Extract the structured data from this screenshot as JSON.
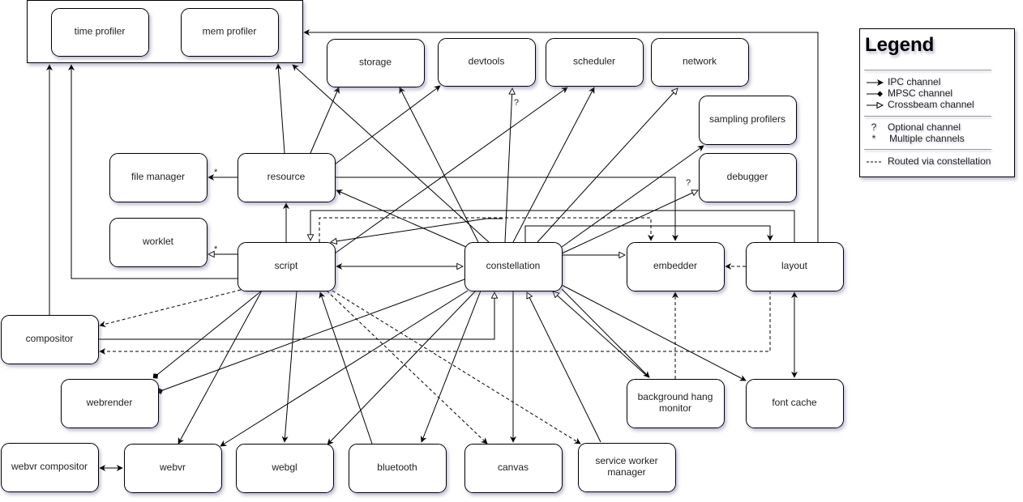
{
  "nodes": [
    {
      "id": "profilers_group",
      "label": ""
    },
    {
      "id": "time_profiler",
      "label": "time profiler"
    },
    {
      "id": "mem_profiler",
      "label": "mem profiler"
    },
    {
      "id": "storage",
      "label": "storage"
    },
    {
      "id": "devtools",
      "label": "devtools"
    },
    {
      "id": "scheduler",
      "label": "scheduler"
    },
    {
      "id": "network",
      "label": "network"
    },
    {
      "id": "sampling_profilers",
      "label": "sampling profilers"
    },
    {
      "id": "debugger",
      "label": "debugger"
    },
    {
      "id": "file_manager",
      "label": "file manager"
    },
    {
      "id": "resource",
      "label": "resource"
    },
    {
      "id": "worklet",
      "label": "worklet"
    },
    {
      "id": "script",
      "label": "script"
    },
    {
      "id": "constellation",
      "label": "constellation"
    },
    {
      "id": "embedder",
      "label": "embedder"
    },
    {
      "id": "layout",
      "label": "layout"
    },
    {
      "id": "compositor",
      "label": "compositor"
    },
    {
      "id": "webrender",
      "label": "webrender"
    },
    {
      "id": "background_hang_monitor",
      "label": "background hang\nmonitor"
    },
    {
      "id": "font_cache",
      "label": "font cache"
    },
    {
      "id": "webvr_compositor",
      "label": "webvr compositor"
    },
    {
      "id": "webvr",
      "label": "webvr"
    },
    {
      "id": "webgl",
      "label": "webgl"
    },
    {
      "id": "bluetooth",
      "label": "bluetooth"
    },
    {
      "id": "canvas",
      "label": "canvas"
    },
    {
      "id": "service_worker_manager",
      "label": "service worker\nmanager"
    }
  ],
  "edges": [
    {
      "from": "resource",
      "to": "file_manager",
      "type": "ipc",
      "mark": "*"
    },
    {
      "from": "resource",
      "to": "mem_profiler",
      "type": "ipc"
    },
    {
      "from": "resource",
      "to": "storage",
      "type": "ipc"
    },
    {
      "from": "resource",
      "to": "devtools",
      "type": "ipc"
    },
    {
      "from": "resource",
      "to": "embedder",
      "type": "ipc"
    },
    {
      "from": "script",
      "to": "resource",
      "type": "ipc"
    },
    {
      "from": "script",
      "to": "worklet",
      "type": "crossbeam",
      "mark": "*"
    },
    {
      "from": "script",
      "to": "time_profiler",
      "type": "ipc"
    },
    {
      "from": "script",
      "to": "devtools",
      "type": "ipc"
    },
    {
      "from": "script",
      "to": "constellation",
      "type": "ipc",
      "bidirectional": true
    },
    {
      "from": "script",
      "to": "compositor",
      "type": "ipc",
      "style": "dashed"
    },
    {
      "from": "script",
      "to": "webrender",
      "type": "mpsc"
    },
    {
      "from": "script",
      "to": "webvr",
      "type": "ipc"
    },
    {
      "from": "script",
      "to": "webgl",
      "type": "ipc"
    },
    {
      "from": "script",
      "to": "canvas",
      "type": "ipc",
      "style": "dashed"
    },
    {
      "from": "script",
      "to": "service_worker_manager",
      "type": "ipc",
      "style": "dashed"
    },
    {
      "from": "script",
      "to": "embedder",
      "type": "ipc",
      "style": "dashed"
    },
    {
      "from": "bluetooth",
      "to": "script",
      "type": "ipc"
    },
    {
      "from": "constellation",
      "to": "mem_profiler",
      "type": "ipc"
    },
    {
      "from": "constellation",
      "to": "storage",
      "type": "ipc"
    },
    {
      "from": "constellation",
      "to": "devtools",
      "type": "crossbeam",
      "mark": "?"
    },
    {
      "from": "constellation",
      "to": "scheduler",
      "type": "ipc"
    },
    {
      "from": "constellation",
      "to": "network",
      "type": "crossbeam"
    },
    {
      "from": "constellation",
      "to": "sampling_profilers",
      "type": "ipc"
    },
    {
      "from": "constellation",
      "to": "debugger",
      "type": "crossbeam",
      "mark": "?"
    },
    {
      "from": "constellation",
      "to": "resource",
      "type": "ipc"
    },
    {
      "from": "constellation",
      "to": "script",
      "type": "crossbeam"
    },
    {
      "from": "constellation",
      "to": "embedder",
      "type": "crossbeam"
    },
    {
      "from": "constellation",
      "to": "layout",
      "type": "ipc"
    },
    {
      "from": "constellation",
      "to": "webrender",
      "type": "mpsc"
    },
    {
      "from": "constellation",
      "to": "webvr",
      "type": "ipc"
    },
    {
      "from": "constellation",
      "to": "webgl",
      "type": "ipc"
    },
    {
      "from": "constellation",
      "to": "bluetooth",
      "type": "ipc"
    },
    {
      "from": "constellation",
      "to": "canvas",
      "type": "ipc"
    },
    {
      "from": "constellation",
      "to": "background_hang_monitor",
      "type": "ipc"
    },
    {
      "from": "constellation",
      "to": "font_cache",
      "type": "ipc"
    },
    {
      "from": "compositor",
      "to": "constellation",
      "type": "crossbeam"
    },
    {
      "from": "compositor",
      "to": "time_profiler",
      "type": "ipc"
    },
    {
      "from": "service_worker_manager",
      "to": "constellation",
      "type": "crossbeam"
    },
    {
      "from": "background_hang_monitor",
      "to": "constellation",
      "type": "crossbeam"
    },
    {
      "from": "background_hang_monitor",
      "to": "embedder",
      "type": "ipc",
      "style": "dashed"
    },
    {
      "from": "layout",
      "to": "embedder",
      "type": "ipc",
      "style": "dashed"
    },
    {
      "from": "layout",
      "to": "compositor",
      "type": "ipc",
      "style": "dashed"
    },
    {
      "from": "layout",
      "to": "profilers_group",
      "type": "ipc"
    },
    {
      "from": "layout",
      "to": "constellation",
      "type": "crossbeam"
    },
    {
      "from": "layout",
      "to": "font_cache",
      "type": "ipc",
      "bidirectional": true
    },
    {
      "from": "webvr",
      "to": "webvr_compositor",
      "type": "ipc",
      "bidirectional": true
    }
  ],
  "legend": {
    "title": "Legend",
    "items": [
      {
        "symbol": "ipc-arrow",
        "label": "IPC channel"
      },
      {
        "symbol": "mpsc-arrow",
        "label": "MPSC channel"
      },
      {
        "symbol": "crossbeam-arrow",
        "label": "Crossbeam channel"
      },
      {
        "symbol": "?",
        "label": "Optional channel"
      },
      {
        "symbol": "*",
        "label": "Multiple channels"
      },
      {
        "symbol": "dashed-line",
        "label": "Routed via constellation"
      }
    ]
  }
}
